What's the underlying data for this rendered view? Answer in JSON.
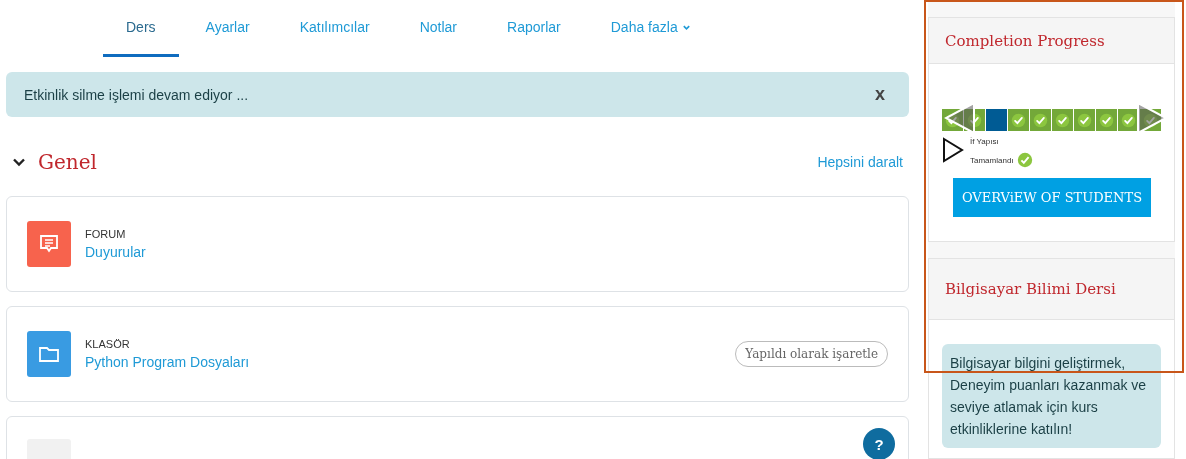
{
  "tabs": [
    {
      "label": "Ders",
      "selected": true
    },
    {
      "label": "Ayarlar",
      "selected": false
    },
    {
      "label": "Katılımcılar",
      "selected": false
    },
    {
      "label": "Notlar",
      "selected": false
    },
    {
      "label": "Raporlar",
      "selected": false
    },
    {
      "label": "Daha fazla",
      "selected": false,
      "kind": "dropdown"
    }
  ],
  "alert": {
    "text": "Etkinlik silme işlemi devam ediyor ...",
    "close": "x"
  },
  "section": {
    "title": "Genel",
    "expanded": true,
    "collapse_link": "Hepsini daralt"
  },
  "activities": [
    {
      "kind": "forum",
      "type_label": "FORUM",
      "name": "Duyurular"
    },
    {
      "kind": "folder",
      "type_label": "KLASÖR",
      "name": "Python Program Dosyaları",
      "action": "Yapıldı olarak işaretle"
    },
    {
      "kind": "blank"
    }
  ],
  "help_button": "?",
  "completion_block": {
    "title": "Completion Progress",
    "cells": [
      {
        "completed": true
      },
      {
        "completed": true
      },
      {
        "completed": false
      },
      {
        "completed": true
      },
      {
        "completed": true
      },
      {
        "completed": true
      },
      {
        "completed": true
      },
      {
        "completed": true
      },
      {
        "completed": true
      },
      {
        "completed": true
      }
    ],
    "activity_name": "İf Yapısı",
    "activity_status": "Tamamlandı",
    "activity_completed": true,
    "button": "OVERViEW OF STUDENTS"
  },
  "course_block": {
    "title": "Bilgisayar Bilimi Dersi",
    "message": "Bilgisayar bilgini geliştirmek, Deneyim puanları kazanmak ve seviye atlamak için kurs etkinliklerine katılın!"
  }
}
